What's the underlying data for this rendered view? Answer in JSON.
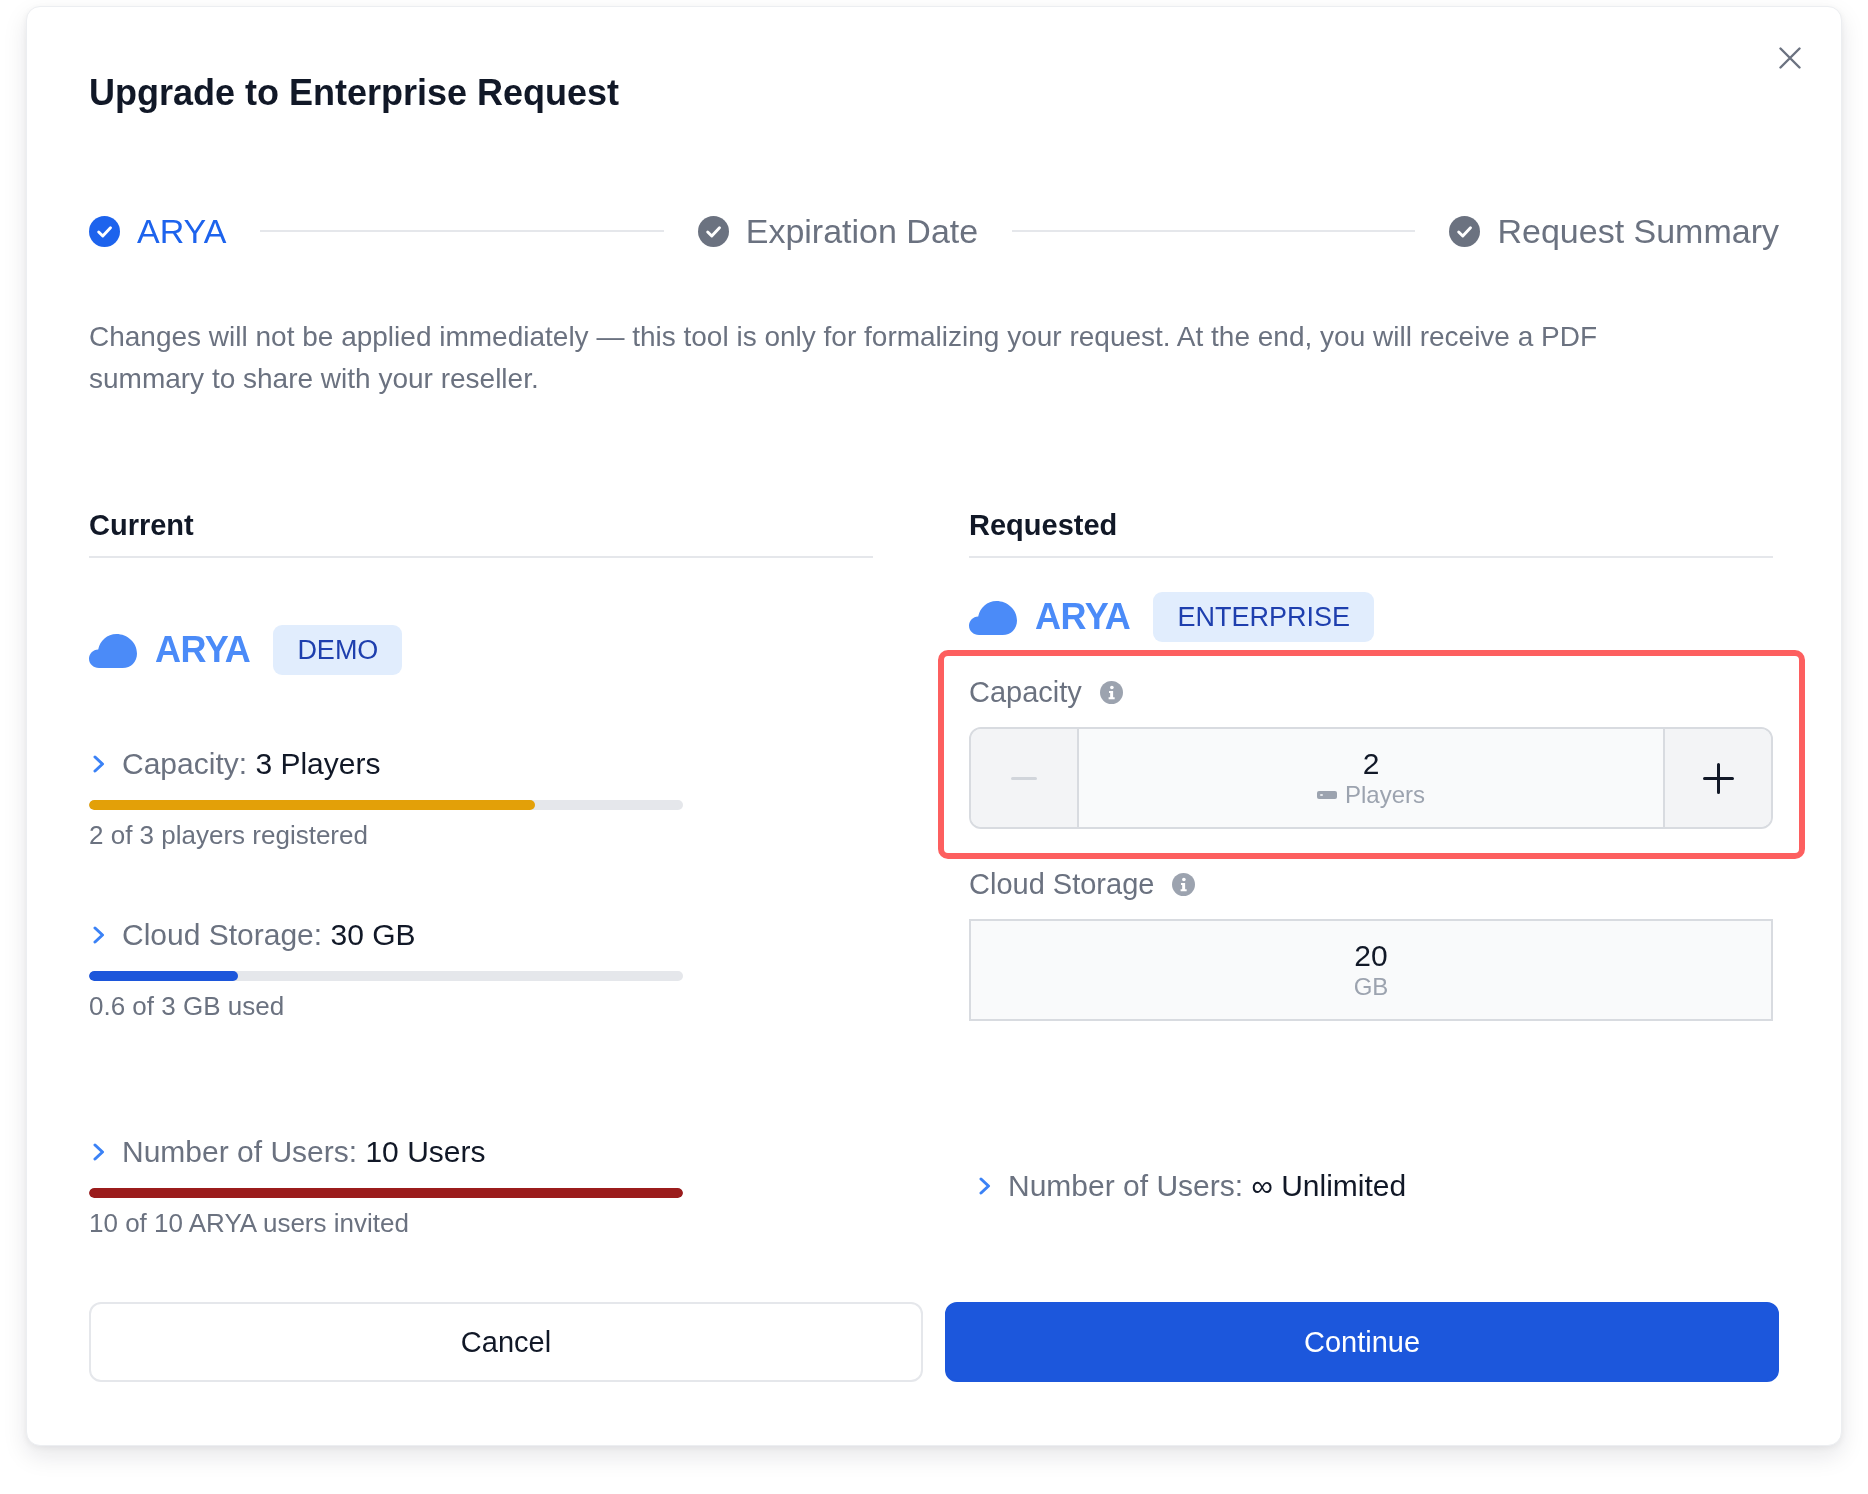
{
  "dialog": {
    "title": "Upgrade to Enterprise Request"
  },
  "steps": [
    {
      "label": "ARYA",
      "selected": true
    },
    {
      "label": "Expiration Date",
      "selected": false
    },
    {
      "label": "Request Summary",
      "selected": false
    }
  ],
  "notice": "Changes will not be applied immediately — this tool is only for formalizing your request. At the end, you will receive a PDF summary to share with your reseller.",
  "current": {
    "heading": "Current",
    "product": {
      "name": "ARYA",
      "plan": "DEMO"
    },
    "metrics": [
      {
        "label": "Capacity:",
        "value": "3 Players",
        "level": 0.75,
        "color": "#e3a008",
        "caption": "2 of 3 players registered"
      },
      {
        "label": "Cloud Storage:",
        "value": "30 GB",
        "level": 0.25,
        "color": "#1c56db",
        "caption": "0.6 of 3 GB used"
      },
      {
        "label": "Number of Users:",
        "value": "10 Users",
        "level": 1,
        "color": "#9b1c1c",
        "caption": "10 of 10 ARYA users invited"
      }
    ]
  },
  "requested": {
    "heading": "Requested",
    "product": {
      "name": "ARYA",
      "plan": "ENTERPRISE"
    },
    "fields": [
      {
        "kind": "stepper",
        "label": "Capacity",
        "highlighted": true,
        "value": "2",
        "unit": "Players",
        "decrement_disabled": true
      },
      {
        "kind": "readonly",
        "label": "Cloud Storage",
        "highlighted": false,
        "value": "20",
        "unit": "GB"
      }
    ],
    "summary": {
      "label": "Number of Users:",
      "value": "∞ Unlimited"
    }
  },
  "buttons": [
    {
      "label": "Cancel",
      "kind": "secondary"
    },
    {
      "label": "Continue",
      "kind": "primary"
    }
  ]
}
